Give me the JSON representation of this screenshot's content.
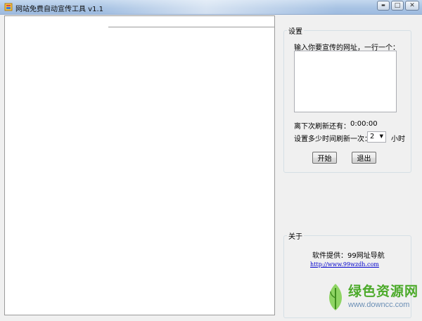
{
  "window": {
    "title": "网站免费自动宣传工具 v1.1",
    "minimize_glyph": "▬",
    "maximize_glyph": "□",
    "close_glyph": "✕"
  },
  "settings": {
    "legend": "设置",
    "url_prompt": "输入你要宣传的网址，一行一个：",
    "urls_value": "",
    "countdown_label": "离下次刷新还有：",
    "countdown_value": "0:00:00",
    "interval_label": "设置多少时间刷新一次：",
    "interval_value": "2",
    "interval_unit": "小时",
    "start_button": "开始",
    "exit_button": "退出"
  },
  "about": {
    "legend": "关于",
    "provider": "软件提供：99网址导航",
    "link": "http://www.99wzdh.com"
  },
  "watermark": {
    "name": "绿色资源网",
    "url": "www.downcc.com"
  },
  "colors": {
    "titlebar": "#a9c4e4",
    "link": "#0000cc",
    "watermark_green": "#4caa2a"
  }
}
